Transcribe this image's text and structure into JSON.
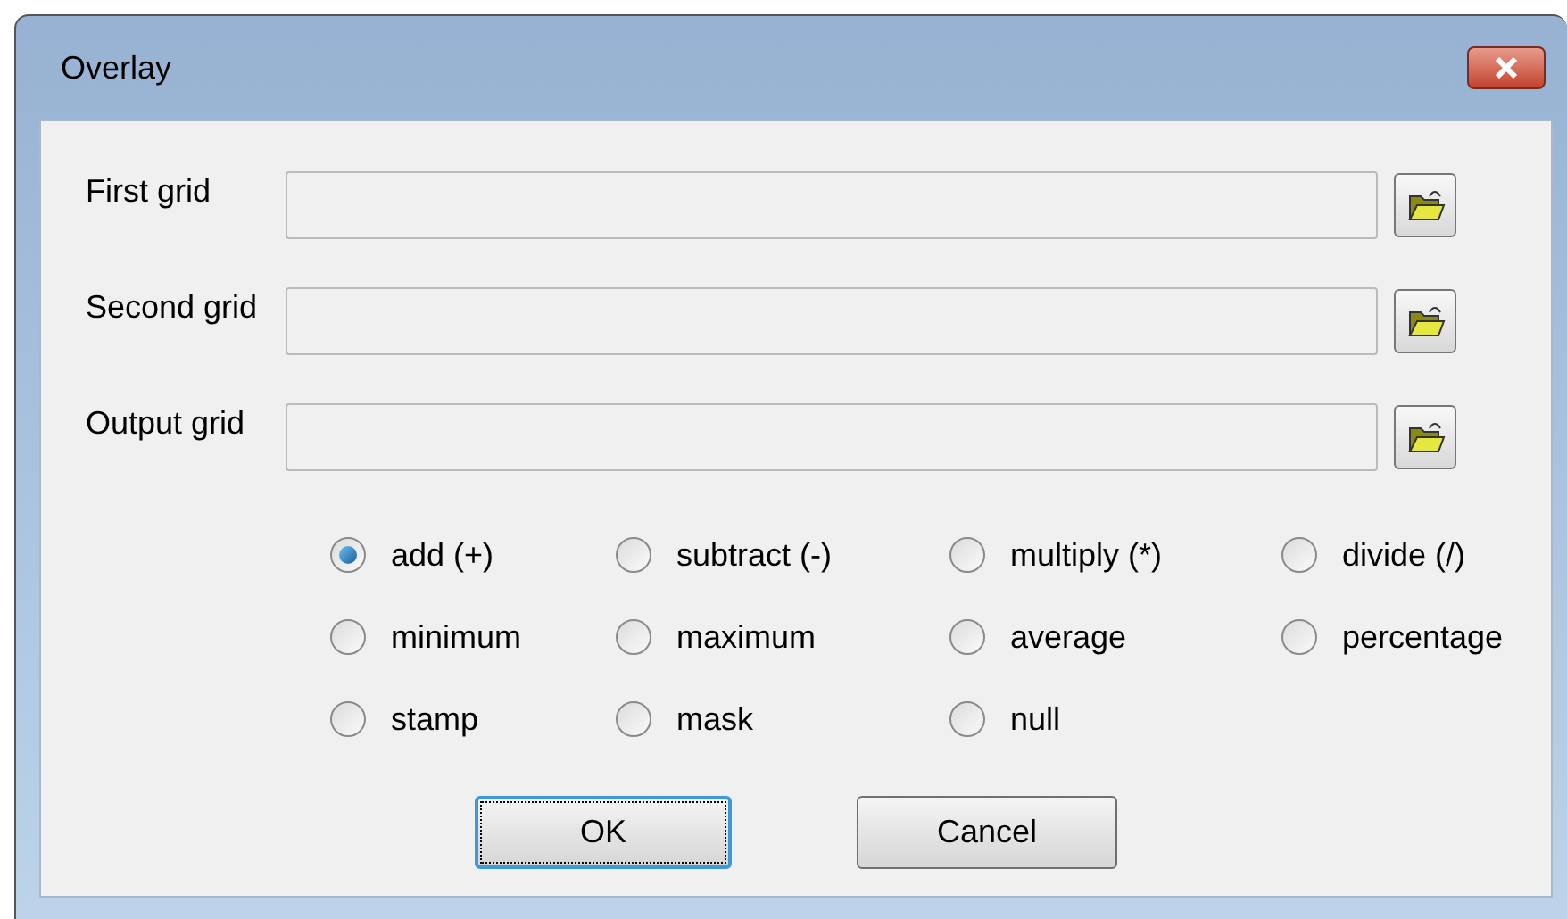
{
  "window": {
    "title": "Overlay"
  },
  "fields": [
    {
      "label": "First grid"
    },
    {
      "label": "Second grid"
    },
    {
      "label": "Output grid"
    }
  ],
  "operations": [
    {
      "label": "add (+)",
      "selected": true
    },
    {
      "label": "subtract (-)",
      "selected": false
    },
    {
      "label": "multiply (*)",
      "selected": false
    },
    {
      "label": "divide (/)",
      "selected": false
    },
    {
      "label": "minimum",
      "selected": false
    },
    {
      "label": "maximum",
      "selected": false
    },
    {
      "label": "average",
      "selected": false
    },
    {
      "label": "percentage",
      "selected": false
    },
    {
      "label": "stamp",
      "selected": false
    },
    {
      "label": "mask",
      "selected": false
    },
    {
      "label": "null",
      "selected": false
    }
  ],
  "buttons": [
    {
      "label": "OK",
      "focused": true
    },
    {
      "label": "Cancel",
      "focused": false
    }
  ]
}
